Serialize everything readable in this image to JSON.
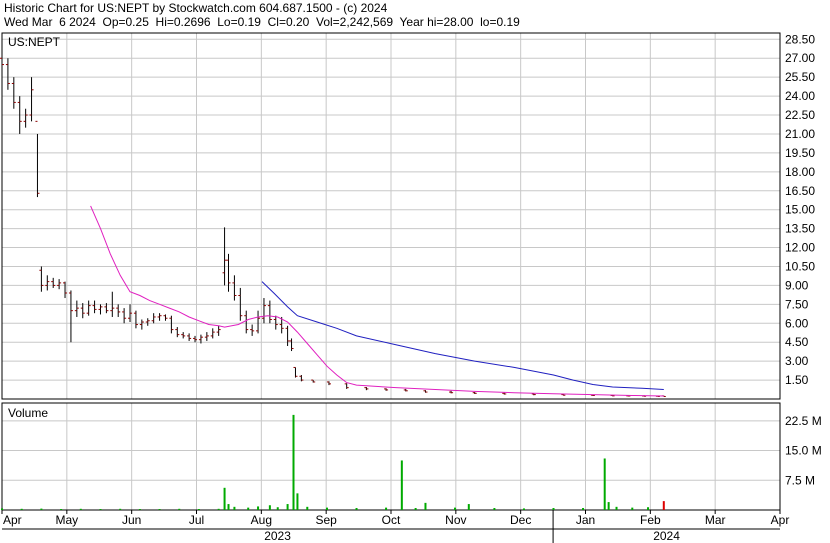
{
  "header": {
    "title": "Historic Chart for US:NEPT by Stockwatch.com 604.687.1500 - (c) 2024",
    "quote": "Wed Mar  6 2024  Op=0.25  Hi=0.2696  Lo=0.19  Cl=0.20  Vol=2,242,569  Year hi=28.00  lo=0.19"
  },
  "colors": {
    "grid": "#c8c8c8",
    "candle": "#8b0000",
    "ma_short": "#e020c0",
    "ma_long": "#2020c0",
    "volume": "#00aa00",
    "volume_last": "#dd0000"
  },
  "chart_data": {
    "type": "candlestick",
    "symbol_label": "US:NEPT",
    "volume_label": "Volume",
    "price_ticks": [
      1.5,
      3,
      4.5,
      6,
      7.5,
      9,
      10.5,
      12,
      13.5,
      15,
      16.5,
      18,
      19.5,
      21,
      22.5,
      24,
      25.5,
      27,
      28.5
    ],
    "price_tick_labels": [
      "1.50",
      "3.00",
      "4.50",
      "6.00",
      "7.50",
      "9.00",
      "10.50",
      "12.00",
      "13.50",
      "15.00",
      "16.50",
      "18.00",
      "19.50",
      "21.00",
      "22.50",
      "24.00",
      "25.50",
      "27.00",
      "28.50"
    ],
    "price_range": [
      0,
      29
    ],
    "volume_ticks": [
      7500000,
      15000000,
      22500000
    ],
    "volume_tick_labels": [
      "7.5 M",
      "15.0 M",
      "22.5 M"
    ],
    "volume_range": [
      0,
      27000000
    ],
    "months": [
      "Apr",
      "May",
      "Jun",
      "Jul",
      "Aug",
      "Sep",
      "Oct",
      "Nov",
      "Dec",
      "Jan",
      "Feb",
      "Mar",
      "Apr"
    ],
    "years": [
      "2023",
      "2024"
    ],
    "day_range": [
      0,
      395
    ],
    "price_series": [
      {
        "d": 0,
        "o": 27,
        "h": 28,
        "l": 26,
        "c": 26.5
      },
      {
        "d": 3,
        "o": 26.5,
        "h": 27,
        "l": 24.5,
        "c": 25
      },
      {
        "d": 6,
        "o": 25,
        "h": 25.5,
        "l": 23,
        "c": 23.5
      },
      {
        "d": 9,
        "o": 23.5,
        "h": 24,
        "l": 21,
        "c": 22
      },
      {
        "d": 12,
        "o": 22,
        "h": 23,
        "l": 21.5,
        "c": 22.5
      },
      {
        "d": 15,
        "o": 22.5,
        "h": 25.5,
        "l": 22,
        "c": 24.5
      },
      {
        "d": 18,
        "o": 22,
        "h": 21,
        "l": 16,
        "c": 16.3
      },
      {
        "d": 20,
        "o": 10.2,
        "h": 10.5,
        "l": 8.5,
        "c": 9
      },
      {
        "d": 23,
        "o": 9,
        "h": 9.8,
        "l": 8.6,
        "c": 9.3
      },
      {
        "d": 26,
        "o": 9.3,
        "h": 9.6,
        "l": 8.8,
        "c": 9
      },
      {
        "d": 29,
        "o": 9,
        "h": 9.5,
        "l": 8.7,
        "c": 9.2
      },
      {
        "d": 32,
        "o": 9.2,
        "h": 9.3,
        "l": 8,
        "c": 8.4
      },
      {
        "d": 35,
        "o": 8.4,
        "h": 8.6,
        "l": 4.5,
        "c": 7
      },
      {
        "d": 38,
        "o": 7,
        "h": 7.8,
        "l": 6.5,
        "c": 7.2
      },
      {
        "d": 41,
        "o": 7.2,
        "h": 7.6,
        "l": 6.4,
        "c": 6.8
      },
      {
        "d": 44,
        "o": 6.8,
        "h": 7.8,
        "l": 6.6,
        "c": 7.4
      },
      {
        "d": 47,
        "o": 7.4,
        "h": 7.8,
        "l": 6.8,
        "c": 7.1
      },
      {
        "d": 50,
        "o": 7.1,
        "h": 7.5,
        "l": 6.7,
        "c": 7.3
      },
      {
        "d": 53,
        "o": 7.3,
        "h": 7.6,
        "l": 6.8,
        "c": 7
      },
      {
        "d": 56,
        "o": 7,
        "h": 8.5,
        "l": 6.5,
        "c": 7.2
      },
      {
        "d": 59,
        "o": 7.2,
        "h": 7.5,
        "l": 6.5,
        "c": 6.9
      },
      {
        "d": 62,
        "o": 6.9,
        "h": 7.2,
        "l": 6,
        "c": 6.4
      },
      {
        "d": 65,
        "o": 6.4,
        "h": 7.5,
        "l": 6.1,
        "c": 6.8
      },
      {
        "d": 68,
        "o": 6.8,
        "h": 7,
        "l": 5.6,
        "c": 5.9
      },
      {
        "d": 71,
        "o": 5.9,
        "h": 6.3,
        "l": 5.5,
        "c": 6.1
      },
      {
        "d": 74,
        "o": 6.1,
        "h": 6.4,
        "l": 5.8,
        "c": 6.2
      },
      {
        "d": 77,
        "o": 6.2,
        "h": 6.8,
        "l": 6,
        "c": 6.5
      },
      {
        "d": 80,
        "o": 6.5,
        "h": 6.8,
        "l": 6.2,
        "c": 6.6
      },
      {
        "d": 83,
        "o": 6.6,
        "h": 6.7,
        "l": 6.2,
        "c": 6.4
      },
      {
        "d": 86,
        "o": 6.4,
        "h": 6.6,
        "l": 5.2,
        "c": 5.5
      },
      {
        "d": 89,
        "o": 5.5,
        "h": 5.7,
        "l": 4.9,
        "c": 5.1
      },
      {
        "d": 92,
        "o": 5.1,
        "h": 5.3,
        "l": 4.8,
        "c": 5
      },
      {
        "d": 95,
        "o": 5,
        "h": 5.2,
        "l": 4.6,
        "c": 4.8
      },
      {
        "d": 98,
        "o": 4.8,
        "h": 5,
        "l": 4.5,
        "c": 4.7
      },
      {
        "d": 101,
        "o": 4.7,
        "h": 5.1,
        "l": 4.4,
        "c": 4.9
      },
      {
        "d": 104,
        "o": 4.9,
        "h": 5.3,
        "l": 4.6,
        "c": 5
      },
      {
        "d": 107,
        "o": 5,
        "h": 5.6,
        "l": 4.8,
        "c": 5.3
      },
      {
        "d": 110,
        "o": 5.3,
        "h": 5.8,
        "l": 5,
        "c": 5.5
      },
      {
        "d": 113,
        "o": 10,
        "h": 13.6,
        "l": 9,
        "c": 11
      },
      {
        "d": 115,
        "o": 11,
        "h": 11.5,
        "l": 8.5,
        "c": 9.2
      },
      {
        "d": 118,
        "o": 9.2,
        "h": 9.8,
        "l": 7.8,
        "c": 8.2
      },
      {
        "d": 121,
        "o": 8.2,
        "h": 8.8,
        "l": 6.2,
        "c": 6.6
      },
      {
        "d": 124,
        "o": 6.6,
        "h": 7,
        "l": 5.2,
        "c": 5.5
      },
      {
        "d": 127,
        "o": 5.5,
        "h": 5.9,
        "l": 5,
        "c": 5.4
      },
      {
        "d": 130,
        "o": 5.4,
        "h": 7,
        "l": 5.2,
        "c": 6.4
      },
      {
        "d": 133,
        "o": 6.4,
        "h": 8,
        "l": 6,
        "c": 7.4
      },
      {
        "d": 136,
        "o": 7.4,
        "h": 7.8,
        "l": 6,
        "c": 6.3
      },
      {
        "d": 139,
        "o": 6.3,
        "h": 6.6,
        "l": 5.5,
        "c": 5.9
      },
      {
        "d": 142,
        "o": 5.9,
        "h": 6.5,
        "l": 5.2,
        "c": 5.6
      },
      {
        "d": 145,
        "o": 5.6,
        "h": 5.8,
        "l": 4.2,
        "c": 4.6
      },
      {
        "d": 147,
        "o": 4.6,
        "h": 4.8,
        "l": 3.8,
        "c": 4
      },
      {
        "d": 149,
        "o": 2.5,
        "h": 2.5,
        "l": 1.7,
        "c": 1.8
      },
      {
        "d": 152,
        "o": 1.8,
        "h": 1.9,
        "l": 1.4,
        "c": 1.5
      },
      {
        "d": 158,
        "o": 1.5,
        "h": 1.5,
        "l": 1.3,
        "c": 1.35
      },
      {
        "d": 166,
        "o": 1.35,
        "h": 1.4,
        "l": 1.1,
        "c": 1.2
      },
      {
        "d": 175,
        "o": 1.2,
        "h": 1.25,
        "l": 0.8,
        "c": 0.9
      },
      {
        "d": 185,
        "o": 0.9,
        "h": 0.95,
        "l": 0.7,
        "c": 0.8
      },
      {
        "d": 195,
        "o": 0.8,
        "h": 0.85,
        "l": 0.65,
        "c": 0.72
      },
      {
        "d": 205,
        "o": 0.72,
        "h": 0.8,
        "l": 0.6,
        "c": 0.65
      },
      {
        "d": 215,
        "o": 0.65,
        "h": 0.7,
        "l": 0.5,
        "c": 0.55
      },
      {
        "d": 228,
        "o": 0.55,
        "h": 0.65,
        "l": 0.45,
        "c": 0.5
      },
      {
        "d": 240,
        "o": 0.5,
        "h": 0.55,
        "l": 0.4,
        "c": 0.45
      },
      {
        "d": 255,
        "o": 0.45,
        "h": 0.5,
        "l": 0.35,
        "c": 0.4
      },
      {
        "d": 270,
        "o": 0.4,
        "h": 0.45,
        "l": 0.3,
        "c": 0.35
      },
      {
        "d": 285,
        "o": 0.35,
        "h": 0.4,
        "l": 0.28,
        "c": 0.3
      },
      {
        "d": 300,
        "o": 0.3,
        "h": 0.35,
        "l": 0.25,
        "c": 0.28
      },
      {
        "d": 310,
        "o": 0.28,
        "h": 0.32,
        "l": 0.22,
        "c": 0.25
      },
      {
        "d": 318,
        "o": 0.25,
        "h": 0.3,
        "l": 0.21,
        "c": 0.24
      },
      {
        "d": 326,
        "o": 0.24,
        "h": 0.3,
        "l": 0.2,
        "c": 0.22
      },
      {
        "d": 333,
        "o": 0.22,
        "h": 0.27,
        "l": 0.19,
        "c": 0.2
      },
      {
        "d": 336,
        "o": 0.25,
        "h": 0.2696,
        "l": 0.19,
        "c": 0.2
      }
    ],
    "ma_short": [
      {
        "d": 45,
        "p": 15.3
      },
      {
        "d": 50,
        "p": 13.5
      },
      {
        "d": 55,
        "p": 11.5
      },
      {
        "d": 60,
        "p": 9.8
      },
      {
        "d": 65,
        "p": 8.5
      },
      {
        "d": 70,
        "p": 8.2
      },
      {
        "d": 75,
        "p": 7.8
      },
      {
        "d": 80,
        "p": 7.5
      },
      {
        "d": 85,
        "p": 7.2
      },
      {
        "d": 90,
        "p": 6.9
      },
      {
        "d": 95,
        "p": 6.5
      },
      {
        "d": 100,
        "p": 6.2
      },
      {
        "d": 105,
        "p": 5.9
      },
      {
        "d": 110,
        "p": 5.8
      },
      {
        "d": 113,
        "p": 5.7
      },
      {
        "d": 120,
        "p": 5.9
      },
      {
        "d": 125,
        "p": 6.3
      },
      {
        "d": 130,
        "p": 6.5
      },
      {
        "d": 135,
        "p": 6.6
      },
      {
        "d": 140,
        "p": 6.5
      },
      {
        "d": 145,
        "p": 6.1
      },
      {
        "d": 150,
        "p": 5.3
      },
      {
        "d": 155,
        "p": 4.4
      },
      {
        "d": 160,
        "p": 3.5
      },
      {
        "d": 165,
        "p": 2.6
      },
      {
        "d": 170,
        "p": 1.9
      },
      {
        "d": 175,
        "p": 1.3
      },
      {
        "d": 180,
        "p": 1.1
      },
      {
        "d": 190,
        "p": 1
      },
      {
        "d": 200,
        "p": 0.9
      },
      {
        "d": 220,
        "p": 0.75
      },
      {
        "d": 240,
        "p": 0.6
      },
      {
        "d": 260,
        "p": 0.5
      },
      {
        "d": 280,
        "p": 0.42
      },
      {
        "d": 300,
        "p": 0.35
      },
      {
        "d": 320,
        "p": 0.28
      },
      {
        "d": 336,
        "p": 0.24
      }
    ],
    "ma_long": [
      {
        "d": 132,
        "p": 9.3
      },
      {
        "d": 138,
        "p": 8.4
      },
      {
        "d": 145,
        "p": 7.3
      },
      {
        "d": 150,
        "p": 6.6
      },
      {
        "d": 160,
        "p": 6.1
      },
      {
        "d": 170,
        "p": 5.6
      },
      {
        "d": 180,
        "p": 5
      },
      {
        "d": 200,
        "p": 4.3
      },
      {
        "d": 220,
        "p": 3.6
      },
      {
        "d": 240,
        "p": 3
      },
      {
        "d": 260,
        "p": 2.5
      },
      {
        "d": 280,
        "p": 1.9
      },
      {
        "d": 290,
        "p": 1.5
      },
      {
        "d": 300,
        "p": 1.15
      },
      {
        "d": 310,
        "p": 0.95
      },
      {
        "d": 325,
        "p": 0.85
      },
      {
        "d": 336,
        "p": 0.75
      }
    ],
    "volume_series": [
      {
        "d": 0,
        "v": 400000
      },
      {
        "d": 10,
        "v": 300000
      },
      {
        "d": 20,
        "v": 350000
      },
      {
        "d": 30,
        "v": 250000
      },
      {
        "d": 40,
        "v": 300000
      },
      {
        "d": 50,
        "v": 250000
      },
      {
        "d": 60,
        "v": 300000
      },
      {
        "d": 70,
        "v": 250000
      },
      {
        "d": 80,
        "v": 250000
      },
      {
        "d": 90,
        "v": 300000
      },
      {
        "d": 100,
        "v": 250000
      },
      {
        "d": 110,
        "v": 300000
      },
      {
        "d": 113,
        "v": 5600000
      },
      {
        "d": 115,
        "v": 1500000
      },
      {
        "d": 118,
        "v": 800000
      },
      {
        "d": 125,
        "v": 600000
      },
      {
        "d": 130,
        "v": 900000
      },
      {
        "d": 136,
        "v": 1200000
      },
      {
        "d": 140,
        "v": 700000
      },
      {
        "d": 145,
        "v": 1500000
      },
      {
        "d": 148,
        "v": 24000000
      },
      {
        "d": 150,
        "v": 4200000
      },
      {
        "d": 155,
        "v": 800000
      },
      {
        "d": 165,
        "v": 600000
      },
      {
        "d": 180,
        "v": 500000
      },
      {
        "d": 195,
        "v": 600000
      },
      {
        "d": 203,
        "v": 12500000
      },
      {
        "d": 210,
        "v": 500000
      },
      {
        "d": 215,
        "v": 1800000
      },
      {
        "d": 230,
        "v": 600000
      },
      {
        "d": 237,
        "v": 1500000
      },
      {
        "d": 250,
        "v": 500000
      },
      {
        "d": 265,
        "v": 400000
      },
      {
        "d": 280,
        "v": 500000
      },
      {
        "d": 295,
        "v": 500000
      },
      {
        "d": 306,
        "v": 13000000
      },
      {
        "d": 308,
        "v": 2000000
      },
      {
        "d": 312,
        "v": 800000
      },
      {
        "d": 320,
        "v": 600000
      },
      {
        "d": 328,
        "v": 700000
      },
      {
        "d": 336,
        "v": 2242569
      }
    ]
  }
}
